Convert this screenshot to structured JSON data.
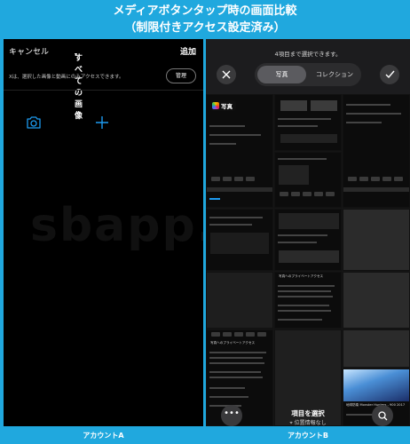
{
  "banner": {
    "line1": "メディアボタンタップ時の画面比較",
    "line2": "（制限付きアクセス設定済み）"
  },
  "left": {
    "cancel": "キャンセル",
    "all_images": "すべての画像",
    "dropdown_glyph": "▾",
    "add": "追加",
    "notice": "Xは、選択した画像と動画にのみアクセスできます。",
    "manage": "管理",
    "watermark": "sbapp.net",
    "icons": [
      "camera-icon",
      "plus-icon"
    ]
  },
  "right": {
    "limit_text": "4項目まで選択できます。",
    "tab_photos": "写真",
    "tab_collections": "コレクション",
    "photos_chip": "写真",
    "privacy_title_1": "写真へのプライベートアクセス",
    "privacy_title_2": "写真へのプライベートアクセス",
    "select_title": "項目を選択",
    "select_sub": "位置情報なし",
    "more_glyph": "•••",
    "video_thumb_title": "地球防衛 Monster Hunters - 900 2017"
  },
  "footer": {
    "account_a": "アカウントA",
    "account_b": "アカウントB"
  },
  "colors": {
    "banner_bg": "#20a8de",
    "accent_blue": "#1d9bf0"
  }
}
